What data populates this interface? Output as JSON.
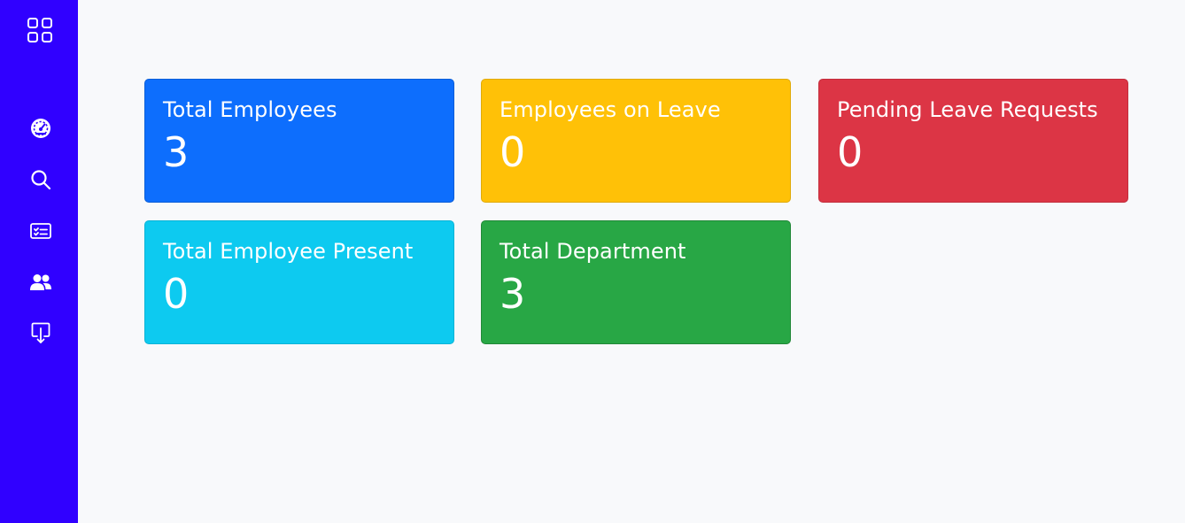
{
  "colors": {
    "sidebar": "#3000ff",
    "background": "#f8f9fb",
    "total_employees": "#0d6efd",
    "employees_on_leave": "#ffc107",
    "pending_leave_requests": "#dc3545",
    "total_employee_present": "#0dcaf0",
    "total_department": "#28a745"
  },
  "sidebar": {
    "items": [
      {
        "icon": "grid-apps-icon"
      },
      {
        "icon": "speedometer-icon"
      },
      {
        "icon": "search-icon"
      },
      {
        "icon": "id-card-icon"
      },
      {
        "icon": "people-icon"
      },
      {
        "icon": "download-icon"
      }
    ]
  },
  "cards": {
    "total_employees": {
      "title": "Total Employees",
      "value": "3"
    },
    "employees_on_leave": {
      "title": "Employees on Leave",
      "value": "0"
    },
    "pending_leave_requests": {
      "title": "Pending Leave Requests",
      "value": "0"
    },
    "total_employee_present": {
      "title": "Total Employee Present",
      "value": "0"
    },
    "total_department": {
      "title": "Total Department",
      "value": "3"
    }
  }
}
